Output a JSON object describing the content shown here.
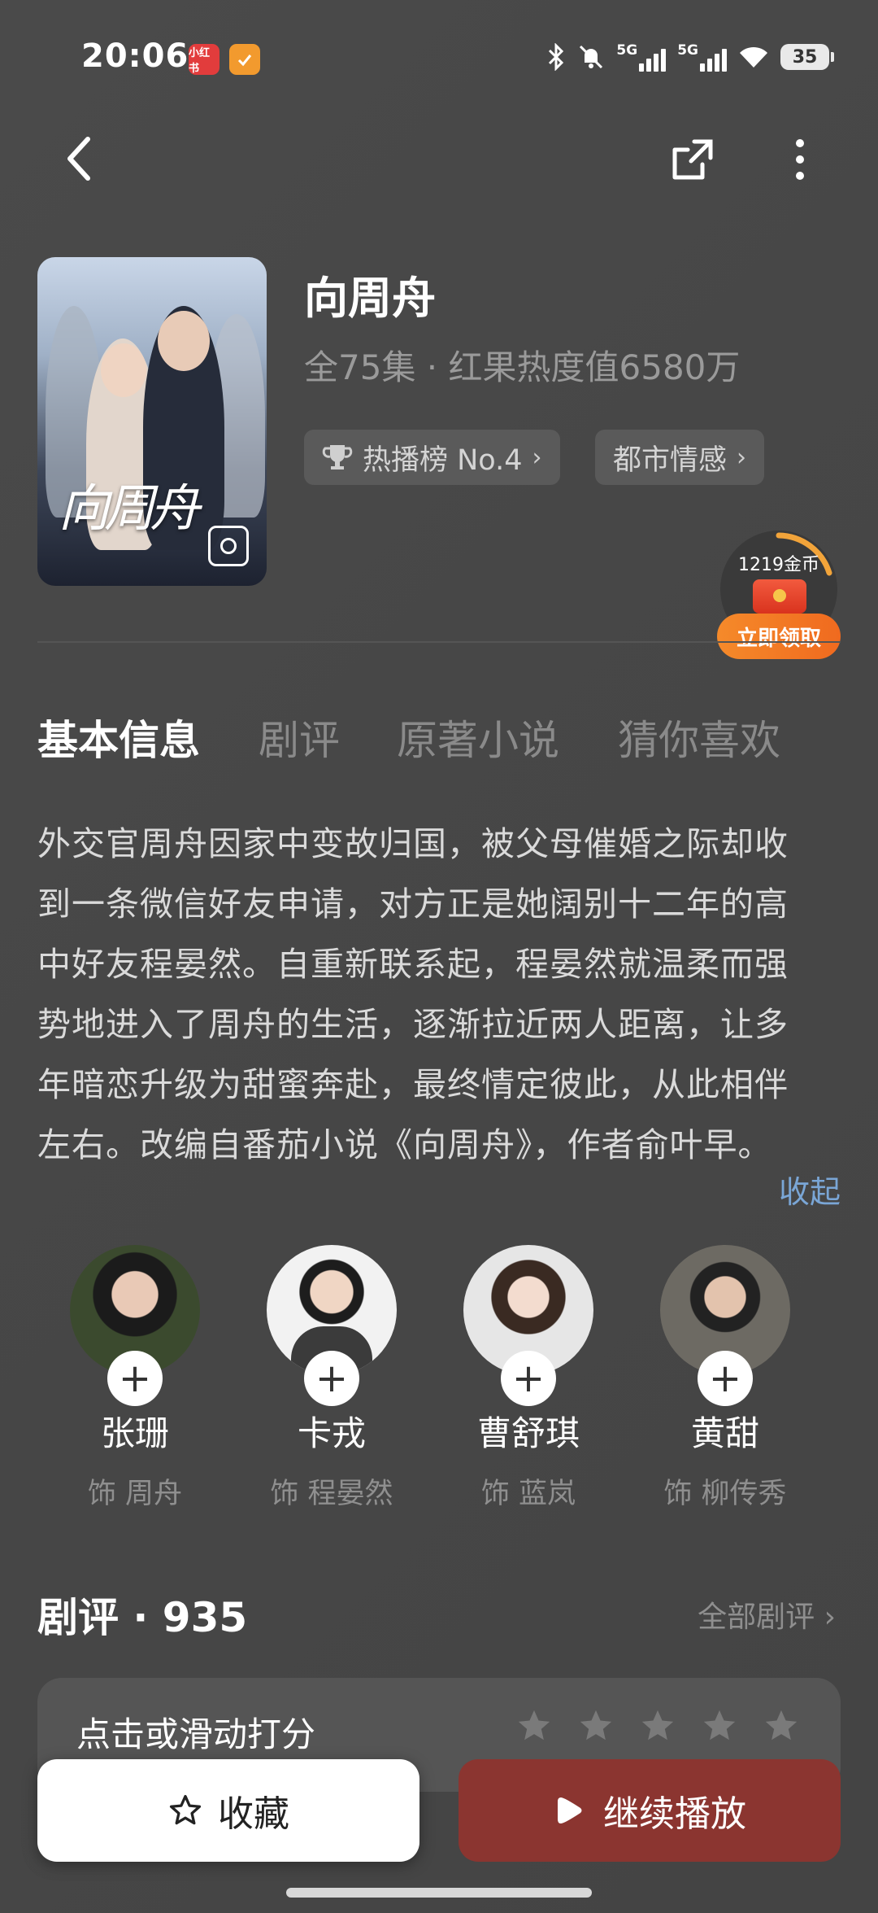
{
  "status_bar": {
    "time": "20:06",
    "app_badge_1": "小红书",
    "network_1": "5G",
    "network_2": "5G",
    "battery": "35",
    "icons": [
      "bluetooth-icon",
      "mute-bell-icon",
      "signal-icon",
      "wifi-icon",
      "battery-icon"
    ]
  },
  "header": {
    "back_icon": "back-arrow-icon",
    "share_icon": "share-icon",
    "more_icon": "more-vertical-icon"
  },
  "show": {
    "title": "向周舟",
    "meta": "全75集 · 红果热度值6580万",
    "poster_title": "向周舟",
    "tags": [
      {
        "icon": "trophy-icon",
        "label": "热播榜 No.4"
      },
      {
        "label": "都市情感"
      }
    ]
  },
  "coin_widget": {
    "amount": "1219金币",
    "button": "立即领取",
    "accent": "#f27a24"
  },
  "tabs": [
    {
      "label": "基本信息",
      "active": true
    },
    {
      "label": "剧评",
      "active": false
    },
    {
      "label": "原著小说",
      "active": false
    },
    {
      "label": "猜你喜欢",
      "active": false
    }
  ],
  "synopsis": {
    "lines": [
      "外交官周舟因家中变故归国，被父母催婚之际却收",
      "到一条微信好友申请，对方正是她阔别十二年的高",
      "中好友程晏然。自重新联系起，程晏然就温柔而强",
      "势地进入了周舟的生活，逐渐拉近两人距离，让多",
      "年暗恋升级为甜蜜奔赴，最终情定彼此，从此相伴",
      "左右。改编自番茄小说《向周舟》，作者俞叶早。"
    ],
    "collapse": "收起"
  },
  "cast": [
    {
      "name": "张珊",
      "role": "饰 周舟"
    },
    {
      "name": "卡戎",
      "role": "饰 程晏然"
    },
    {
      "name": "曹舒琪",
      "role": "饰 蓝岚"
    },
    {
      "name": "黄甜",
      "role": "饰 柳传秀"
    }
  ],
  "reviews": {
    "title": "剧评 · 935",
    "all_link": "全部剧评",
    "rating_prompt": "点击或滑动打分",
    "stars": 5
  },
  "bottom_bar": {
    "favorite": "收藏",
    "continue": "继续播放",
    "play_color": "#8b3530"
  }
}
